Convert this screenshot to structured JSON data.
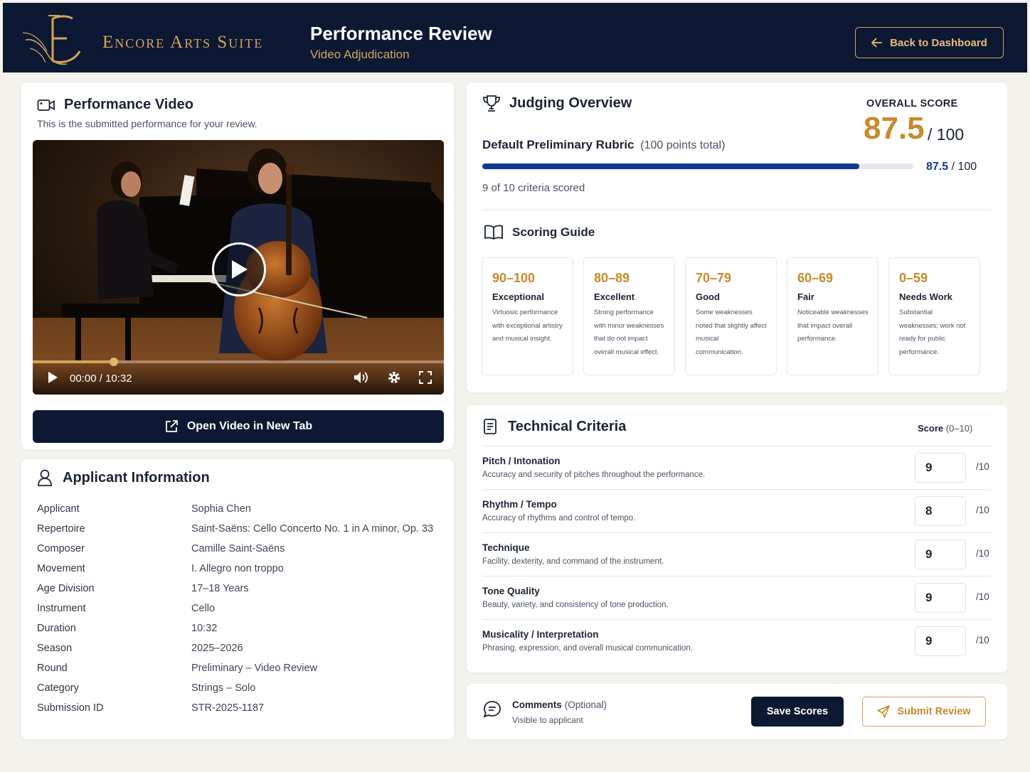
{
  "header": {
    "brand": "Encore Arts Suite",
    "title": "Performance Review",
    "subtitle": "Video Adjudication",
    "back_label": "Back to Dashboard"
  },
  "video": {
    "title": "Performance Video",
    "description": "This is the submitted performance for your review.",
    "current_time": "00:00",
    "duration": "10:32",
    "progress_fraction": 0.197,
    "open_label": "Open Video in New Tab"
  },
  "applicant": {
    "title": "Applicant Information",
    "rows": [
      {
        "label": "Applicant",
        "value": "Sophia Chen"
      },
      {
        "label": "Repertoire",
        "value": "Saint-Saëns: Cello Concerto No. 1 in A minor, Op. 33"
      },
      {
        "label": "Composer",
        "value": "Camille Saint-Saëns"
      },
      {
        "label": "Movement",
        "value": "I. Allegro non troppo"
      },
      {
        "label": "Age Division",
        "value": "17–18 Years"
      },
      {
        "label": "Instrument",
        "value": "Cello"
      },
      {
        "label": "Duration",
        "value": "10:32"
      },
      {
        "label": "Season",
        "value": "2025–2026"
      },
      {
        "label": "Round",
        "value": "Preliminary – Video Review"
      },
      {
        "label": "Category",
        "value": "Strings – Solo"
      },
      {
        "label": "Submission ID",
        "value": "STR-2025-1187"
      }
    ]
  },
  "overview": {
    "title": "Judging Overview",
    "rubric_name": "Default Preliminary Rubric",
    "rubric_points": "(100 points total)",
    "score_label": "OVERALL SCORE",
    "score": "87.5",
    "score_max": "/ 100",
    "bar_score": "87.5",
    "bar_max": "/ 100",
    "score_fraction": 0.875,
    "criteria_scored": "9 of 10 criteria scored",
    "guide_title": "Scoring Guide",
    "guide": [
      {
        "range": "90–100",
        "name": "Exceptional",
        "desc": "Virtuosic performance with exceptional artistry and musical insight."
      },
      {
        "range": "80–89",
        "name": "Excellent",
        "desc": "Strong performance with minor weaknesses that do not impact overall musical effect."
      },
      {
        "range": "70–79",
        "name": "Good",
        "desc": "Some weaknesses noted that slightly affect musical communication."
      },
      {
        "range": "60–69",
        "name": "Fair",
        "desc": "Noticeable weaknesses that impact overall performance."
      },
      {
        "range": "0–59",
        "name": "Needs Work",
        "desc": "Substantial weaknesses; work not ready for public performance."
      }
    ]
  },
  "technical": {
    "title": "Technical Criteria",
    "score_head": "Score",
    "score_range": "(0–10)",
    "criteria": [
      {
        "name": "Pitch / Intonation",
        "desc": "Accuracy and security of pitches throughout the performance.",
        "score": "9",
        "max": "/10"
      },
      {
        "name": "Rhythm / Tempo",
        "desc": "Accuracy of rhythms and control of tempo.",
        "score": "8",
        "max": "/10"
      },
      {
        "name": "Technique",
        "desc": "Facility, dexterity, and command of the instrument.",
        "score": "9",
        "max": "/10"
      },
      {
        "name": "Tone Quality",
        "desc": "Beauty, variety, and consistency of tone production.",
        "score": "9",
        "max": "/10"
      },
      {
        "name": "Musicality / Interpretation",
        "desc": "Phrasing, expression, and overall musical communication.",
        "score": "9",
        "max": "/10"
      }
    ]
  },
  "comments": {
    "title": "Comments",
    "optional": "(Optional)",
    "subtitle": "Visible to applicant",
    "save_label": "Save Scores",
    "submit_label": "Submit Review"
  },
  "colors": {
    "navy": "#0d1833",
    "gold": "#d3a65a",
    "score_gold": "#c9892c",
    "progress_blue": "#0f3a8f"
  }
}
